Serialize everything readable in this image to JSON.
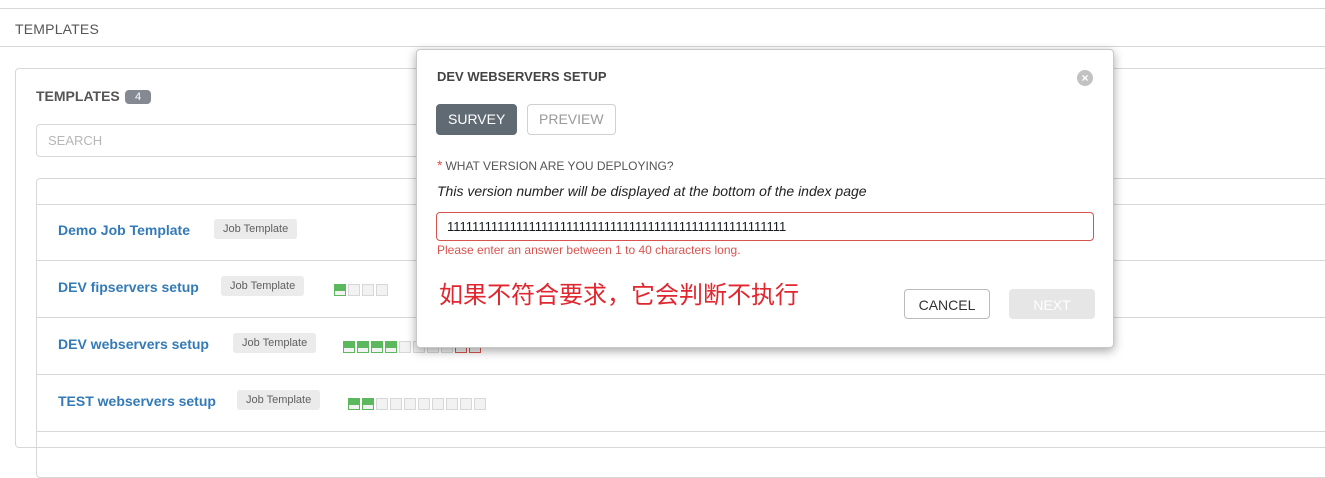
{
  "page_header": {
    "title": "TEMPLATES"
  },
  "panel": {
    "title": "TEMPLATES",
    "count": "4",
    "search_placeholder": "SEARCH"
  },
  "rows": [
    {
      "name": "Demo Job Template",
      "type": "Job Template",
      "jobs": []
    },
    {
      "name": "DEV fipservers setup",
      "type": "Job Template",
      "jobs": [
        "success",
        "empty",
        "empty",
        "empty"
      ]
    },
    {
      "name": "DEV webservers setup",
      "type": "Job Template",
      "jobs": [
        "success",
        "success",
        "success",
        "success",
        "empty",
        "empty",
        "empty",
        "empty",
        "fail",
        "fail"
      ]
    },
    {
      "name": "TEST webservers setup",
      "type": "Job Template",
      "jobs": [
        "success",
        "success",
        "empty",
        "empty",
        "empty",
        "empty",
        "empty",
        "empty",
        "empty",
        "empty"
      ]
    }
  ],
  "modal": {
    "title": "DEV WEBSERVERS SETUP",
    "close_glyph": "×",
    "tabs": {
      "survey": "SURVEY",
      "preview": "PREVIEW"
    },
    "question": {
      "required_mark": "*",
      "label": "WHAT VERSION ARE YOU DEPLOYING?",
      "description": "This version number will be displayed at the bottom of the index page",
      "value": "111111111111111111111111111111111111111111111111111111",
      "error": "Please enter an answer between 1 to 40 characters long."
    },
    "annotation": "如果不符合要求，它会判断不执行",
    "buttons": {
      "cancel": "CANCEL",
      "next": "NEXT"
    }
  },
  "colors": {
    "link": "#337ab7",
    "success": "#5cb85c",
    "fail": "#d9534f",
    "annotation": "#e0262e",
    "active_tab": "#606a73"
  }
}
